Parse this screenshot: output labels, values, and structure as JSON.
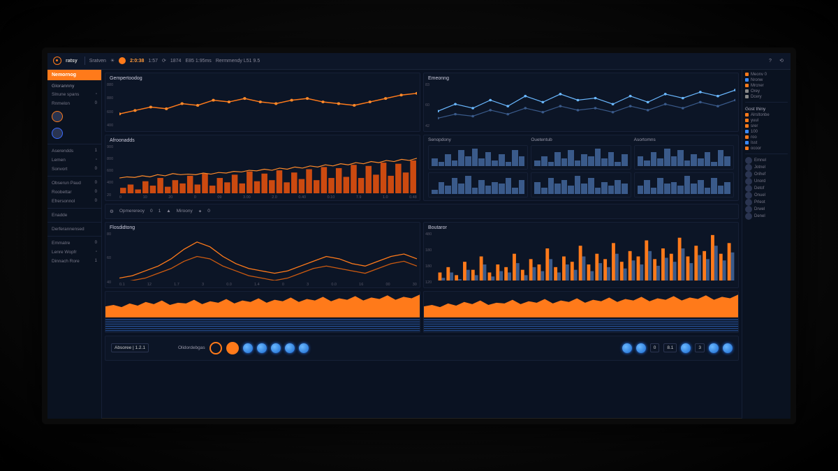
{
  "colors": {
    "accent": "#ff7a1a",
    "accent2": "#3a8aff",
    "bg": "#0a1222"
  },
  "header": {
    "brand": "ratsy",
    "items": [
      "Sratven",
      "",
      "2:0:38",
      "1:57",
      "1874",
      "E85 1:95ms",
      "Rermmendy L51 9.5"
    ],
    "icons": [
      "help-icon",
      "refresh-icon"
    ]
  },
  "sidebar": {
    "active": "Nemornog",
    "sections": [
      {
        "head": "Glorannny",
        "items": [
          {
            "label": "Slnune spans",
            "badge": ""
          },
          {
            "label": "Rnmelon",
            "badge": "0"
          },
          {
            "label": "Avatars",
            "badge": ""
          }
        ]
      },
      {
        "head": "",
        "items": [
          {
            "label": "Aserendds",
            "badge": "1"
          },
          {
            "label": "Lemen",
            "badge": ""
          },
          {
            "label": "Sonvort",
            "badge": "0"
          }
        ]
      },
      {
        "head": "",
        "items": [
          {
            "label": "Obserun Paud",
            "badge": "0"
          },
          {
            "label": "Roobettar",
            "badge": "0"
          },
          {
            "label": "Efrersonnol",
            "badge": "0"
          }
        ]
      },
      {
        "head": "",
        "items": [
          {
            "label": "Enadde",
            "badge": ""
          }
        ]
      },
      {
        "head": "",
        "items": [
          {
            "label": "Derferannensed",
            "badge": ""
          }
        ]
      },
      {
        "head": "",
        "items": [
          {
            "label": "Emmatre",
            "badge": "0"
          },
          {
            "label": "Lenre Wopfr",
            "badge": ""
          },
          {
            "label": "Dinnach Rore",
            "badge": "1"
          }
        ]
      }
    ]
  },
  "panels": {
    "p1": {
      "title": "Gempertoodog",
      "yticks": [
        "880",
        "880",
        "600",
        "400"
      ]
    },
    "p2": {
      "title": "Emeonng",
      "yticks": [
        "83",
        "60",
        "42"
      ]
    },
    "p3": {
      "title": "Afroonadds",
      "yticks": [
        "900",
        "800",
        "600",
        "400",
        "20"
      ],
      "xticks": [
        "0",
        "10",
        "20",
        "0",
        "09",
        "3.00",
        "2.0",
        "0.40",
        "0.10",
        "7.9",
        "1.0",
        "0.48"
      ]
    },
    "mini_titles": [
      "Senopdony",
      "Ouetentub",
      "Asortomns"
    ],
    "stats": [
      "Opmerereoy",
      "0",
      "1",
      "Miroony",
      "0"
    ],
    "p4": {
      "title": "Flosdidtong",
      "yticks": [
        "80",
        "60",
        "40"
      ],
      "xticks": [
        "0.1",
        "12",
        "1.7",
        "3",
        "0.0",
        "1.4",
        "0",
        "3",
        "0.0",
        "16",
        "00",
        "30"
      ]
    },
    "p5": {
      "title": "Boutaror",
      "yticks": [
        "480",
        "180",
        "180",
        "120"
      ]
    }
  },
  "footer": {
    "left_box": "Absoree | 1.2.1",
    "mid_label": "Olidordebgas",
    "vals": [
      "0",
      "8.1",
      "3"
    ]
  },
  "right_panel": {
    "section1": [
      "Meonv 0",
      "Nronw",
      "Mrcner",
      "Orey",
      "Dcery"
    ],
    "head2": "Gost thiny",
    "section2": [
      "Alrsltonbe",
      "yuul",
      "srer",
      "100",
      "roo",
      "Isst",
      "ocoor"
    ],
    "users": [
      "Emnel",
      "Jotnel",
      "Orihef",
      "Unord",
      "Detof",
      "Onuel",
      "Prleot",
      "Drwel",
      "Denel"
    ]
  },
  "chart_data": [
    {
      "id": "p1",
      "type": "line",
      "title": "Gempertoodog",
      "x": [
        0,
        1,
        2,
        3,
        4,
        5,
        6,
        7,
        8,
        9,
        10,
        11,
        12,
        13,
        14,
        15,
        16,
        17,
        18,
        19
      ],
      "series": [
        {
          "name": "main",
          "color": "#ff7a1a",
          "values": [
            520,
            560,
            600,
            580,
            640,
            620,
            680,
            660,
            700,
            660,
            640,
            680,
            700,
            660,
            640,
            620,
            660,
            700,
            740,
            760
          ]
        }
      ],
      "ylim": [
        400,
        880
      ]
    },
    {
      "id": "p2",
      "type": "line",
      "title": "Emeonng",
      "x": [
        0,
        1,
        2,
        3,
        4,
        5,
        6,
        7,
        8,
        9,
        10,
        11,
        12,
        13,
        14,
        15,
        16,
        17
      ],
      "series": [
        {
          "name": "a",
          "color": "#6ab8ff",
          "values": [
            55,
            62,
            58,
            66,
            60,
            70,
            64,
            72,
            66,
            68,
            62,
            70,
            64,
            72,
            68,
            74,
            70,
            76
          ]
        },
        {
          "name": "b",
          "color": "#3a5a8a",
          "values": [
            48,
            52,
            50,
            56,
            52,
            58,
            54,
            60,
            56,
            58,
            54,
            60,
            56,
            62,
            58,
            64,
            60,
            66
          ]
        }
      ],
      "ylim": [
        42,
        83
      ]
    },
    {
      "id": "p3",
      "type": "bar+line",
      "title": "Afroonadds",
      "x": [
        0,
        1,
        2,
        3,
        4,
        5,
        6,
        7,
        8,
        9,
        10,
        11,
        12,
        13,
        14,
        15,
        16,
        17,
        18,
        19,
        20,
        21,
        22,
        23,
        24,
        25,
        26,
        27,
        28,
        29,
        30,
        31,
        32,
        33,
        34,
        35,
        36,
        37,
        38,
        39
      ],
      "bars": [
        120,
        180,
        90,
        240,
        160,
        300,
        140,
        260,
        200,
        340,
        180,
        380,
        160,
        300,
        220,
        360,
        200,
        420,
        240,
        380,
        260,
        440,
        220,
        400,
        280,
        460,
        260,
        500,
        300,
        480,
        320,
        540,
        300,
        520,
        360,
        580,
        340,
        560,
        400,
        620
      ],
      "line": [
        300,
        320,
        310,
        340,
        320,
        360,
        340,
        380,
        360,
        370,
        360,
        390,
        370,
        400,
        390,
        420,
        410,
        440,
        430,
        460,
        440,
        480,
        460,
        500,
        480,
        520,
        500,
        540,
        520,
        560,
        540,
        580,
        560,
        600,
        580,
        620,
        600,
        640,
        620,
        660
      ],
      "ylim": [
        20,
        900
      ]
    },
    {
      "id": "mini1",
      "type": "bar",
      "values": [
        4,
        2,
        6,
        3,
        8,
        5,
        9,
        4,
        7,
        3,
        6,
        2,
        8,
        5
      ]
    },
    {
      "id": "mini2",
      "type": "bar",
      "values": [
        3,
        5,
        2,
        7,
        4,
        8,
        3,
        6,
        5,
        9,
        4,
        7,
        2,
        6
      ]
    },
    {
      "id": "mini3",
      "type": "bar",
      "values": [
        5,
        3,
        7,
        4,
        9,
        5,
        8,
        3,
        6,
        4,
        7,
        2,
        8,
        5
      ]
    },
    {
      "id": "mini4",
      "type": "bar",
      "values": [
        2,
        6,
        4,
        8,
        5,
        9,
        3,
        7,
        4,
        6,
        5,
        8,
        3,
        7
      ]
    },
    {
      "id": "mini5",
      "type": "bar",
      "values": [
        6,
        3,
        8,
        5,
        7,
        4,
        9,
        5,
        8,
        3,
        6,
        4,
        7,
        5
      ]
    },
    {
      "id": "mini6",
      "type": "bar",
      "values": [
        4,
        7,
        3,
        8,
        5,
        6,
        4,
        9,
        5,
        7,
        3,
        8,
        4,
        6
      ]
    },
    {
      "id": "p4",
      "type": "line",
      "title": "Flosdidtong",
      "x": [
        0,
        1,
        2,
        3,
        4,
        5,
        6,
        7,
        8,
        9,
        10,
        11,
        12,
        13,
        14,
        15,
        16,
        17,
        18,
        19,
        20,
        21,
        22,
        23
      ],
      "series": [
        {
          "name": "a",
          "color": "#ff7a1a",
          "values": [
            42,
            44,
            48,
            52,
            58,
            66,
            72,
            68,
            60,
            54,
            50,
            48,
            46,
            48,
            52,
            56,
            60,
            58,
            54,
            52,
            56,
            60,
            62,
            58
          ]
        },
        {
          "name": "b",
          "color": "#cc5a10",
          "values": [
            38,
            40,
            42,
            46,
            50,
            56,
            60,
            58,
            52,
            48,
            44,
            42,
            40,
            42,
            46,
            50,
            52,
            50,
            48,
            46,
            50,
            54,
            56,
            52
          ]
        }
      ],
      "ylim": [
        40,
        80
      ]
    },
    {
      "id": "p5",
      "type": "bar",
      "title": "Boutaror",
      "x": [
        0,
        1,
        2,
        3,
        4,
        5,
        6,
        7,
        8,
        9,
        10,
        11,
        12,
        13,
        14,
        15,
        16,
        17,
        18,
        19,
        20,
        21,
        22,
        23,
        24,
        25,
        26,
        27,
        28,
        29,
        30,
        31,
        32,
        33,
        34,
        35
      ],
      "series": [
        {
          "name": "o",
          "color": "#ff7a1a",
          "values": [
            180,
            220,
            160,
            260,
            200,
            300,
            180,
            240,
            220,
            320,
            200,
            280,
            240,
            360,
            220,
            300,
            260,
            380,
            240,
            320,
            280,
            400,
            260,
            340,
            300,
            420,
            280,
            360,
            320,
            440,
            300,
            380,
            340,
            460,
            320,
            400
          ]
        },
        {
          "name": "b",
          "color": "#3a5a8a",
          "values": [
            140,
            180,
            130,
            200,
            160,
            240,
            150,
            190,
            180,
            250,
            160,
            220,
            190,
            280,
            180,
            240,
            200,
            300,
            190,
            250,
            220,
            320,
            210,
            270,
            240,
            340,
            230,
            290,
            260,
            360,
            250,
            310,
            280,
            380,
            270,
            330
          ]
        }
      ],
      "ylim": [
        120,
        480
      ]
    },
    {
      "id": "area",
      "type": "area",
      "x": [
        0,
        1,
        2,
        3,
        4,
        5,
        6,
        7,
        8,
        9,
        10,
        11,
        12,
        13,
        14,
        15,
        16,
        17,
        18,
        19,
        20,
        21,
        22,
        23,
        24,
        25,
        26,
        27,
        28,
        29,
        30,
        31,
        32,
        33,
        34,
        35,
        36,
        37,
        38,
        39
      ],
      "values": [
        30,
        34,
        28,
        38,
        32,
        42,
        36,
        46,
        34,
        40,
        38,
        48,
        36,
        44,
        40,
        50,
        38,
        46,
        42,
        52,
        40,
        48,
        44,
        54,
        42,
        50,
        46,
        56,
        44,
        52,
        48,
        58,
        46,
        54,
        50,
        60,
        48,
        56,
        52,
        62
      ],
      "ylim": [
        0,
        70
      ]
    }
  ]
}
